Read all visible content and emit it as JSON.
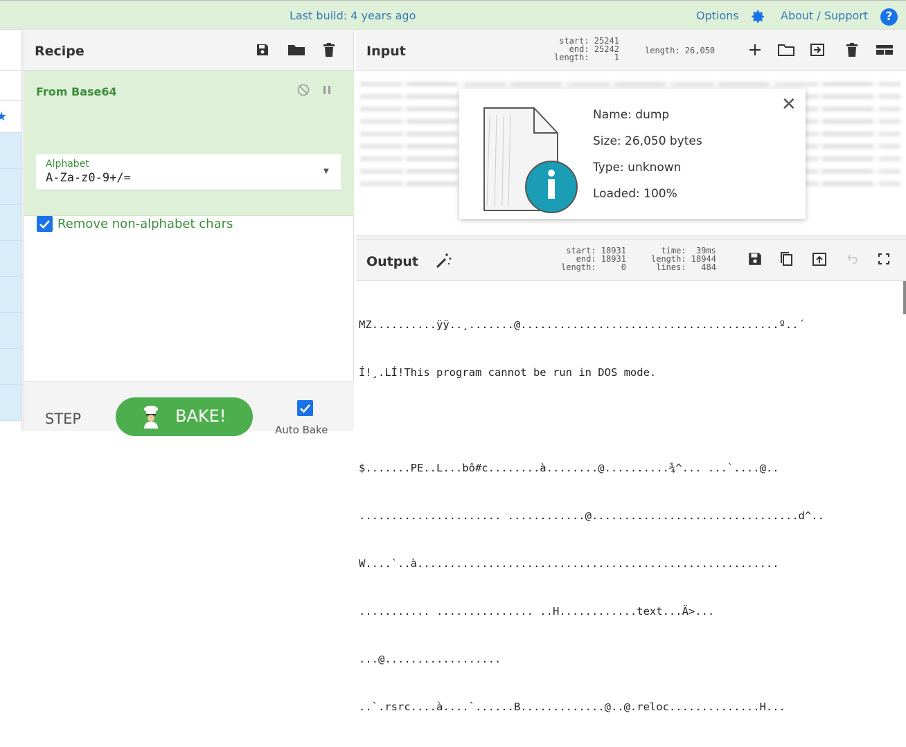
{
  "topbar": {
    "build": "Last build: 4 years ago",
    "options": "Options",
    "about": "About / Support",
    "help_glyph": "?"
  },
  "recipe": {
    "title": "Recipe",
    "operation": {
      "name": "From Base64",
      "alphabet_label": "Alphabet",
      "alphabet_value": "A-Za-z0-9+/=",
      "remove_label": "Remove non-alphabet chars",
      "remove_checked": true
    },
    "step_label": "STEP",
    "bake_label": "BAKE!",
    "auto_bake_label": "Auto Bake",
    "auto_bake_checked": true
  },
  "input": {
    "title": "Input",
    "stats_sel": "start: 25241\n  end: 25242\nlength:     1",
    "stats_len": "length: 26,050",
    "file": {
      "name": "Name: dump",
      "size": "Size: 26,050 bytes",
      "type": "Type: unknown",
      "loaded": "Loaded: 100%"
    }
  },
  "output": {
    "title": "Output",
    "stats_sel": "start: 18931\n  end: 18931\nlength:     0",
    "stats_meta": "time:  39ms\nlength: 18944\n lines:   484",
    "lines": [
      "MZ..........ÿÿ..¸.......@........................................º..´",
      "Í!¸.LÍ!This program cannot be run in DOS mode.",
      "",
      "$.......PE..L...bô#c........à........@..........¾^... ...`....@..",
      "...................... ............@................................d^..",
      "W....`..à........................................................",
      "........... ............... ..H............text...Ä>...",
      "...@..................",
      "..`.rsrc....à....`......B.............@..@.reloc..............H..."
    ]
  }
}
